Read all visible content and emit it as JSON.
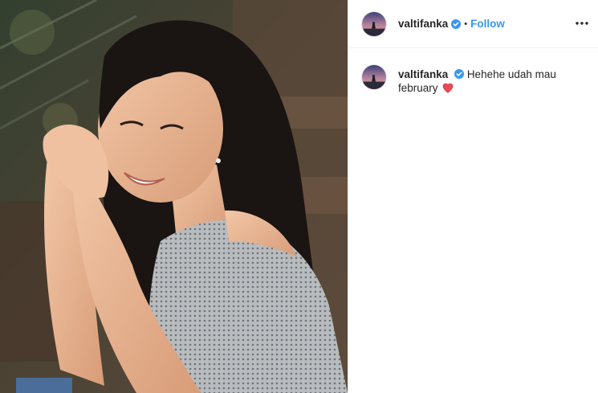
{
  "post": {
    "photo_alt": "photo",
    "header": {
      "username": "valtifanka",
      "separator": "•",
      "follow_label": "Follow",
      "more_icon": "more-horizontal-icon"
    },
    "caption": {
      "username": "valtifanka",
      "text": "Hehehe udah mau february",
      "emoji": "heart-icon"
    }
  },
  "colors": {
    "link_blue": "#3897f0",
    "verified_blue": "#3897f0",
    "text": "#262626",
    "heart_red": "#ed4956",
    "divider": "#efefef"
  }
}
